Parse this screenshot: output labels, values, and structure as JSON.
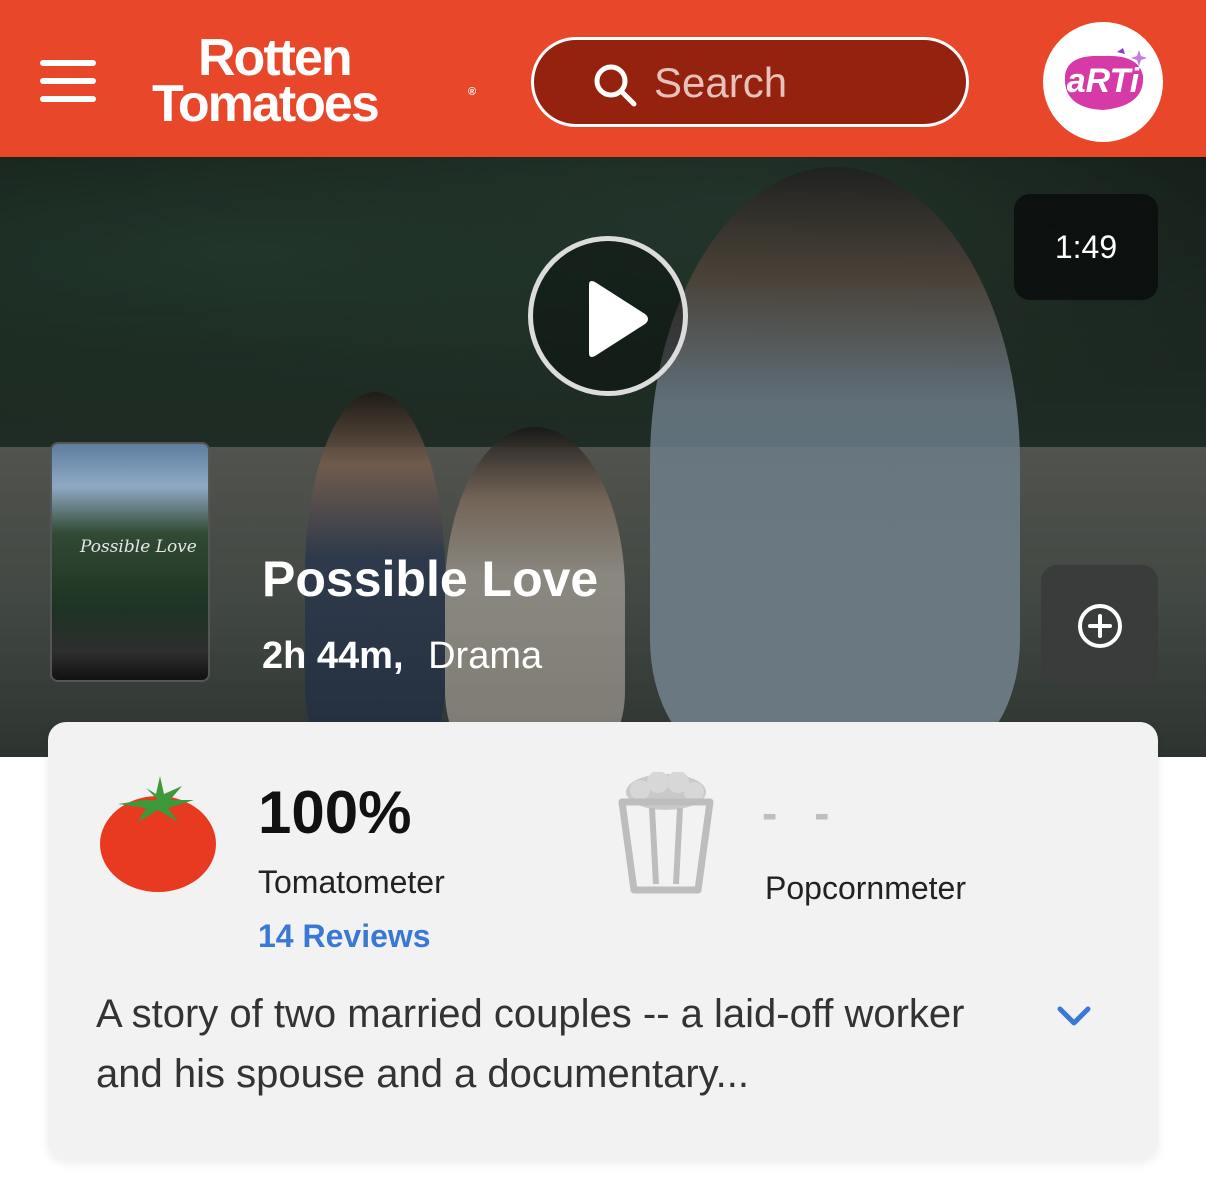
{
  "header": {
    "logo_line1": "Rotten",
    "logo_line2": "Tomatoes",
    "search_placeholder": "Search",
    "avatar_text": "aRTi",
    "brand_color": "#e9472a"
  },
  "hero": {
    "video_duration": "1:49",
    "poster_title": "Possible Love",
    "movie_title": "Possible Love",
    "runtime": "2h 44m,",
    "genre": "Drama"
  },
  "scores": {
    "tomatometer_value": "100%",
    "tomatometer_label": "Tomatometer",
    "reviews": "14 Reviews",
    "popcornmeter_value": "- -",
    "popcornmeter_label": "Popcornmeter",
    "link_color": "#3a78d6"
  },
  "synopsis": {
    "text": "A story of two married couples -- a laid-off worker and his spouse and a documentary..."
  },
  "icons": {
    "menu": "hamburger-menu-icon",
    "search": "search-icon",
    "play": "play-icon",
    "add": "add-to-watchlist-icon",
    "tomato": "fresh-tomato-icon",
    "popcorn": "empty-popcorn-icon",
    "expand": "chevron-down-icon"
  }
}
